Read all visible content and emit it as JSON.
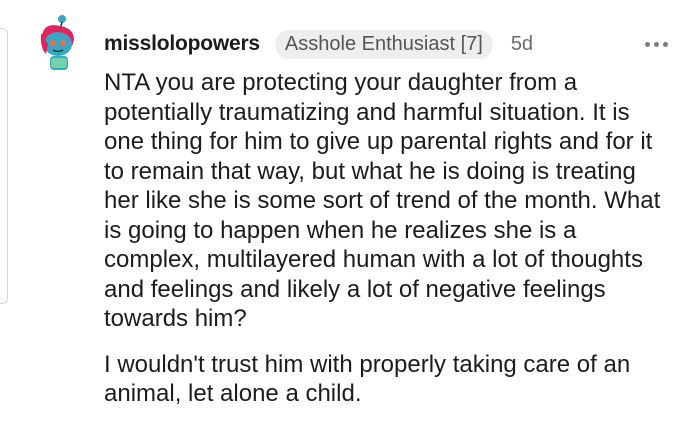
{
  "comment": {
    "username": "misslolopowers",
    "flair": "Asshole Enthusiast [7]",
    "age": "5d",
    "more_icon": "more-horizontal-icon",
    "avatar_icon": "snoo-avatar-icon",
    "paragraphs": [
      "NTA you are protecting your daughter from a potentially traumatizing and harmful situation. It is one thing for him to give up parental rights and for it to remain that way, but what he is doing is treating her like she is some sort of trend of the month. What is going to happen when he realizes she is a complex, multilayered human with a lot of thoughts and feelings and likely a lot of negative feelings towards him?",
      "I wouldn't trust him with properly taking care of an animal, let alone a child."
    ]
  },
  "colors": {
    "text": "#1c1c1c",
    "meta": "#6b6b6b",
    "flair_bg": "#eeeeee",
    "avatar_skin": "#3aa6c4",
    "avatar_hair": "#e0245e"
  }
}
